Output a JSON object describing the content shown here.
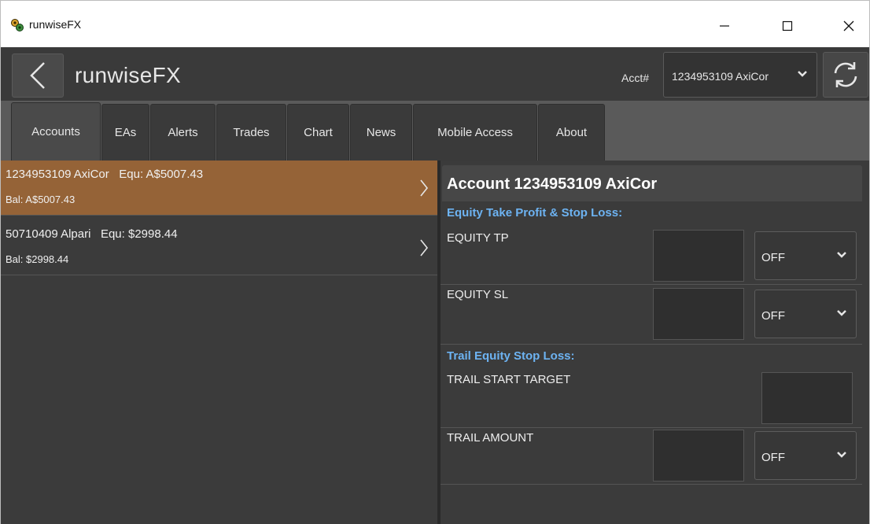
{
  "window": {
    "title": "runwiseFX",
    "controls": [
      "minimize",
      "maximize",
      "close"
    ]
  },
  "header": {
    "title": "runwiseFX",
    "acct_label": "Acct#",
    "acct_selected": "1234953109 AxiCor",
    "icons": [
      "back-arrow-icon",
      "chevron-down-icon",
      "refresh-icon"
    ]
  },
  "tabs": [
    {
      "label": "Accounts",
      "active": true
    },
    {
      "label": "EAs"
    },
    {
      "label": "Alerts"
    },
    {
      "label": "Trades"
    },
    {
      "label": "Chart"
    },
    {
      "label": "News"
    },
    {
      "label": "Mobile Access"
    },
    {
      "label": "About"
    }
  ],
  "accounts": [
    {
      "name": "1234953109 AxiCor",
      "equity": "Equ: A$5007.43",
      "balance": "Bal: A$5007.43",
      "selected": true
    },
    {
      "name": "50710409 Alpari",
      "equity": "Equ: $2998.44",
      "balance": "Bal: $2998.44",
      "selected": false
    }
  ],
  "detail": {
    "title": "Account 1234953109 AxiCor",
    "equity_section": "Equity Take Profit & Stop Loss:",
    "equity_tp_label": "EQUITY TP",
    "equity_tp_value": "",
    "equity_tp_mode": "OFF",
    "equity_sl_label": "EQUITY SL",
    "equity_sl_value": "",
    "equity_sl_mode": "OFF",
    "trail_section": "Trail Equity Stop Loss:",
    "trail_start_label": "TRAIL START TARGET",
    "trail_start_value": "",
    "trail_amount_label": "TRAIL AMOUNT",
    "trail_amount_value": "",
    "trail_amount_mode": "OFF"
  },
  "colors": {
    "selected_row": "#956337",
    "section_title": "#6db3f2",
    "background": "#3b3b3b"
  }
}
